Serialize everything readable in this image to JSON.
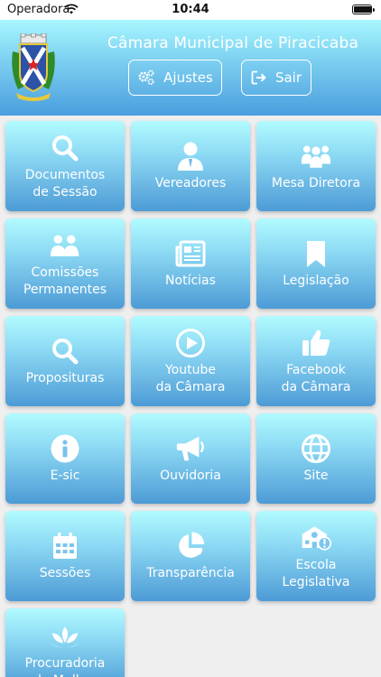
{
  "status": {
    "carrier": "Operadora",
    "time": "10:44"
  },
  "header": {
    "title": "Câmara Municipal de Piracicaba",
    "settings_label": "Ajustes",
    "logout_label": "Sair"
  },
  "menu": [
    {
      "label": "Documentos\nde Sessão",
      "icon": "search-icon"
    },
    {
      "label": "Vereadores",
      "icon": "person-icon"
    },
    {
      "label": "Mesa Diretora",
      "icon": "group-icon"
    },
    {
      "label": "Comissões\nPermanentes",
      "icon": "users-icon"
    },
    {
      "label": "Notícias",
      "icon": "newspaper-icon"
    },
    {
      "label": "Legislação",
      "icon": "bookmark-icon"
    },
    {
      "label": "Proposituras",
      "icon": "search-icon"
    },
    {
      "label": "Youtube\nda Câmara",
      "icon": "play-icon"
    },
    {
      "label": "Facebook\nda Câmara",
      "icon": "thumbs-up-icon"
    },
    {
      "label": "E-sic",
      "icon": "info-icon"
    },
    {
      "label": "Ouvidoria",
      "icon": "megaphone-icon"
    },
    {
      "label": "Site",
      "icon": "globe-icon"
    },
    {
      "label": "Sessões",
      "icon": "calendar-icon"
    },
    {
      "label": "Transparência",
      "icon": "pie-chart-icon"
    },
    {
      "label": "Escola\nLegislativa",
      "icon": "school-icon"
    },
    {
      "label": "Procuradoria\nda Mulher",
      "icon": "lotus-icon"
    }
  ],
  "colors": {
    "tile_top": "#b1fbff",
    "tile_bottom": "#4d9bd6",
    "background": "#efefef"
  }
}
